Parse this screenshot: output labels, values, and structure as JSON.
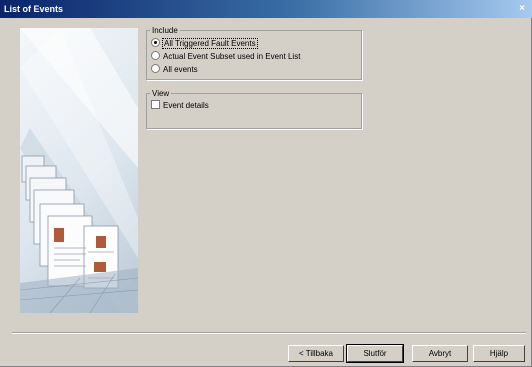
{
  "window": {
    "title": "List of Events",
    "close_glyph": "×"
  },
  "include": {
    "legend": "Include",
    "options": [
      {
        "label": "All Triggered Fault Events",
        "selected": true
      },
      {
        "label": "Actual Event Subset used in Event List",
        "selected": false
      },
      {
        "label": "All events",
        "selected": false
      }
    ]
  },
  "view": {
    "legend": "View",
    "event_details_label": "Event details",
    "event_details_checked": false
  },
  "buttons": {
    "back": "< Tillbaka",
    "next": "Slutför",
    "cancel": "Avbryt",
    "help": "Hjälp"
  },
  "icons": {
    "close": "close-icon",
    "wizard_art": "wizard-pages-illustration"
  }
}
